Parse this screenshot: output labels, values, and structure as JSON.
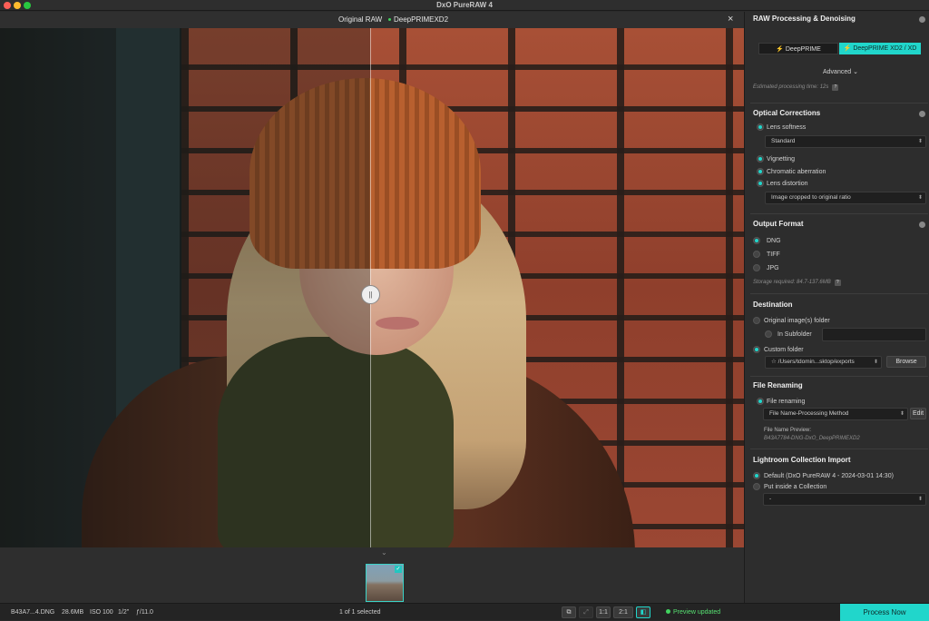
{
  "window": {
    "title": "DxO PureRAW 4"
  },
  "compare": {
    "left_label": "Original RAW",
    "right_label": "DeepPRIMEXD2",
    "close": "×"
  },
  "status": {
    "filename": "B43A7...4.DNG",
    "filesize": "28.6MB",
    "iso": "ISO 100",
    "shutter": "1/2\"",
    "aperture": "ƒ/11.0",
    "selection": "1 of 1 selected",
    "zoom_1": "1:1",
    "zoom_2": "2:1",
    "preview": "Preview updated",
    "process": "Process Now"
  },
  "raw": {
    "title": "RAW Processing & Denoising",
    "opt1": "DeepPRIME",
    "opt2": "DeepPRIME XD2 / XD",
    "advanced": "Advanced",
    "est_label": "Estimated processing time:",
    "est_value": "12s"
  },
  "optical": {
    "title": "Optical Corrections",
    "lens_softness": "Lens softness",
    "softness_value": "Standard",
    "vignetting": "Vignetting",
    "chromatic": "Chromatic aberration",
    "distortion": "Lens distortion",
    "distortion_value": "Image cropped to original ratio"
  },
  "output": {
    "title": "Output Format",
    "dng": "DNG",
    "tiff": "TIFF",
    "jpg": "JPG",
    "storage": "Storage required: 84.7-137.6MB"
  },
  "destination": {
    "title": "Destination",
    "original": "Original image(s) folder",
    "subfolder": "In Subfolder",
    "custom": "Custom folder",
    "path": "/Users/tdomin...sktop/exports",
    "browse": "Browse"
  },
  "renaming": {
    "title": "File Renaming",
    "toggle": "File renaming",
    "method": "File Name-Processing Method",
    "edit": "Edit",
    "preview_label": "File Name Preview:",
    "preview_value": "B43A7784-DNG-DxO_DeepPRIMEXD2"
  },
  "lightroom": {
    "title": "Lightroom Collection Import",
    "default": "Default (DxO PureRAW 4 - 2024-03-01 14:30)",
    "inside": "Put inside a Collection",
    "collection_value": "-"
  },
  "colors": {
    "accent": "#21d6cb",
    "status_green": "#41d35f"
  }
}
